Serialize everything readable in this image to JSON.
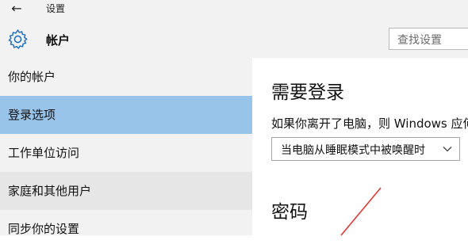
{
  "titlebar": {
    "back_icon": "back-arrow-icon",
    "back_glyph": "←",
    "title": "设置"
  },
  "header": {
    "icon": "gear-icon",
    "title": "帐户",
    "search_placeholder": "查找设置"
  },
  "sidebar": {
    "items": [
      {
        "label": "你的帐户",
        "state": "normal"
      },
      {
        "label": "登录选项",
        "state": "selected"
      },
      {
        "label": "工作单位访问",
        "state": "normal"
      },
      {
        "label": "家庭和其他用户",
        "state": "hover"
      },
      {
        "label": "同步你的设置",
        "state": "normal"
      }
    ]
  },
  "main": {
    "require_signin": {
      "heading": "需要登录",
      "description": "如果你离开了电脑，则 Windows 应何",
      "dropdown_value": "当电脑从睡眠模式中被唤醒时"
    },
    "password": {
      "heading": "密码"
    }
  },
  "colors": {
    "selected": "#99c4ea",
    "hover": "#e6e6e6",
    "sidebar_bg": "#f2f2f2",
    "annotation_line": "#e0302a"
  }
}
